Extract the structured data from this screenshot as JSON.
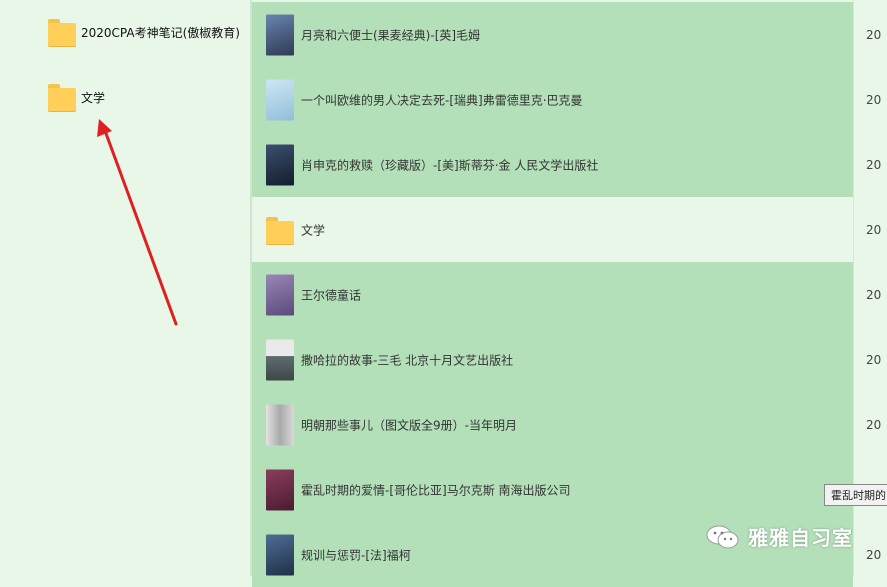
{
  "left_pane": {
    "items": [
      {
        "label": "2020CPA考神笔记(傲椒教育)"
      },
      {
        "label": "文学"
      }
    ]
  },
  "right_pane": {
    "rows": [
      {
        "label": "月亮和六便士(果麦经典)-[英]毛姆",
        "date": "20",
        "selected": true,
        "thumb_color": "#4a5a7a"
      },
      {
        "label": "一个叫欧维的男人决定去死-[瑞典]弗雷德里克·巴克曼",
        "date": "20",
        "selected": true,
        "thumb_color": "#a9d0e6"
      },
      {
        "label": "肖申克的救赎（珍藏版）-[美]斯蒂芬·金 人民文学出版社",
        "date": "20",
        "selected": true,
        "thumb_color": "#2c3a52"
      },
      {
        "label": "文学",
        "date": "20",
        "selected": false,
        "folder": true
      },
      {
        "label": "王尔德童话",
        "date": "20",
        "selected": true,
        "thumb_color": "#7b6a9a"
      },
      {
        "label": "撒哈拉的故事-三毛 北京十月文艺出版社",
        "date": "20",
        "selected": true,
        "thumb_color": "#6e7b7d"
      },
      {
        "label": "明朝那些事儿（图文版全9册）-当年明月",
        "date": "20",
        "selected": true,
        "thumb_color": "#c9c9c9"
      },
      {
        "label": "霍乱时期的爱情-[哥伦比亚]马尔克斯  南海出版公司",
        "date": "20",
        "selected": true,
        "thumb_color": "#6b2f4a"
      },
      {
        "label": "规训与惩罚-[法]福柯",
        "date": "20",
        "selected": true,
        "thumb_color": "#2f4a6b"
      }
    ]
  },
  "tooltip": {
    "text": "霍乱时期的"
  },
  "watermark": {
    "text": "雅雅自习室"
  },
  "colors": {
    "selected_bg": "#b3e0b8",
    "pane_bg": "#e9f7e9",
    "arrow": "#e02020",
    "folder": "#ffcf5a"
  }
}
